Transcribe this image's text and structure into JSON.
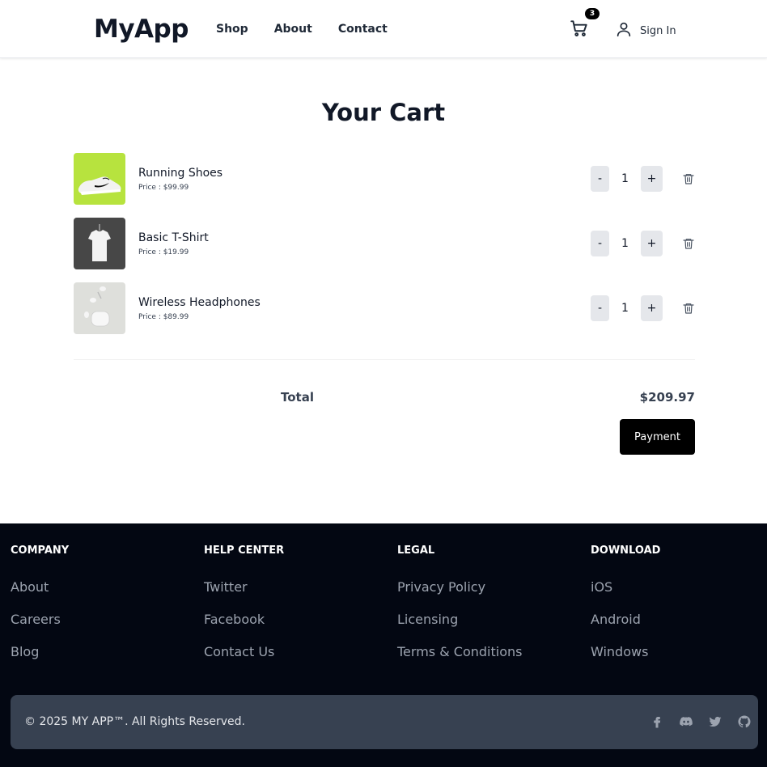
{
  "header": {
    "logo": "MyApp",
    "nav": [
      "Shop",
      "About",
      "Contact"
    ],
    "cart_count": "3",
    "sign_in": "Sign In"
  },
  "cart": {
    "title": "Your Cart",
    "items": [
      {
        "name": "Running Shoes",
        "price": "Price : $99.99",
        "qty": "1",
        "thumb": "shoe-image"
      },
      {
        "name": "Basic T-Shirt",
        "price": "Price : $19.99",
        "qty": "1",
        "thumb": "tshirt-image"
      },
      {
        "name": "Wireless Headphones",
        "price": "Price : $89.99",
        "qty": "1",
        "thumb": "earbuds-image"
      }
    ],
    "minus_label": "-",
    "plus_label": "+",
    "total_label": "Total",
    "total_value": "$209.97",
    "payment_label": "Payment"
  },
  "footer": {
    "columns": [
      {
        "heading": "COMPANY",
        "links": [
          "About",
          "Careers",
          "Blog"
        ]
      },
      {
        "heading": "HELP CENTER",
        "links": [
          "Twitter",
          "Facebook",
          "Contact Us"
        ]
      },
      {
        "heading": "LEGAL",
        "links": [
          "Privacy Policy",
          "Licensing",
          "Terms & Conditions"
        ]
      },
      {
        "heading": "DOWNLOAD",
        "links": [
          "iOS",
          "Android",
          "Windows"
        ]
      }
    ],
    "copyright": "© 2025 MY APP™. All Rights Reserved.",
    "socials": [
      "facebook-icon",
      "discord-icon",
      "twitter-icon",
      "github-icon"
    ]
  },
  "colors": {
    "footer_bg": "#030712",
    "footer_bar": "#374151",
    "button": "#000000",
    "qty_bg": "#e5e7eb",
    "shoe_bg": "#b7e33e"
  }
}
